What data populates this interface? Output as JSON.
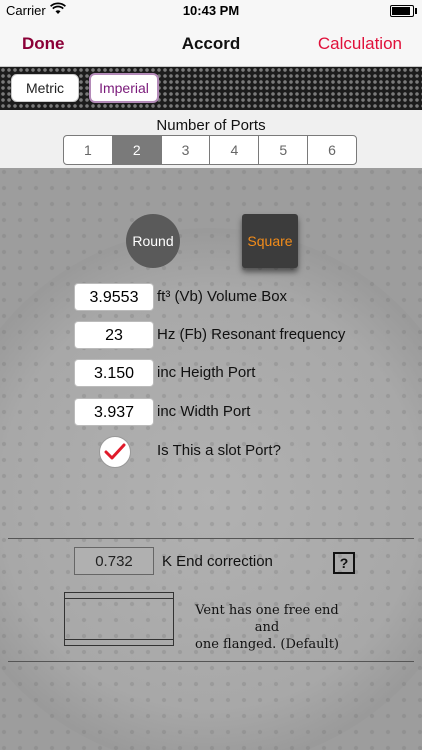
{
  "status": {
    "carrier": "Carrier",
    "time": "10:43 PM"
  },
  "nav": {
    "done": "Done",
    "title": "Accord",
    "calculation": "Calculation"
  },
  "units": {
    "metric": "Metric",
    "imperial": "Imperial"
  },
  "ports": {
    "label": "Number of Ports",
    "options": [
      "1",
      "2",
      "3",
      "4",
      "5",
      "6"
    ],
    "selected": "2"
  },
  "shape": {
    "round": "Round",
    "square": "Square"
  },
  "fields": {
    "volume": {
      "value": "3.9553",
      "label": "ft³  (Vb) Volume Box"
    },
    "frequency": {
      "value": "23",
      "label": "Hz  (Fb) Resonant frequency"
    },
    "height": {
      "value": "3.150",
      "label": "inc  Heigth Port"
    },
    "width": {
      "value": "3.937",
      "label": "inc  Width Port"
    },
    "slot": {
      "label": "Is This a slot Port?"
    }
  },
  "end_correction": {
    "value": "0.732",
    "label": "K  End correction",
    "help": "?"
  },
  "vent": {
    "line1": "Vent has one free end and",
    "line2": "one flanged. (Default)"
  },
  "colors": {
    "accent_dark": "#8b0037",
    "accent_red": "#e0103a",
    "orange": "#f28c1a",
    "check": "#e01a2a"
  }
}
